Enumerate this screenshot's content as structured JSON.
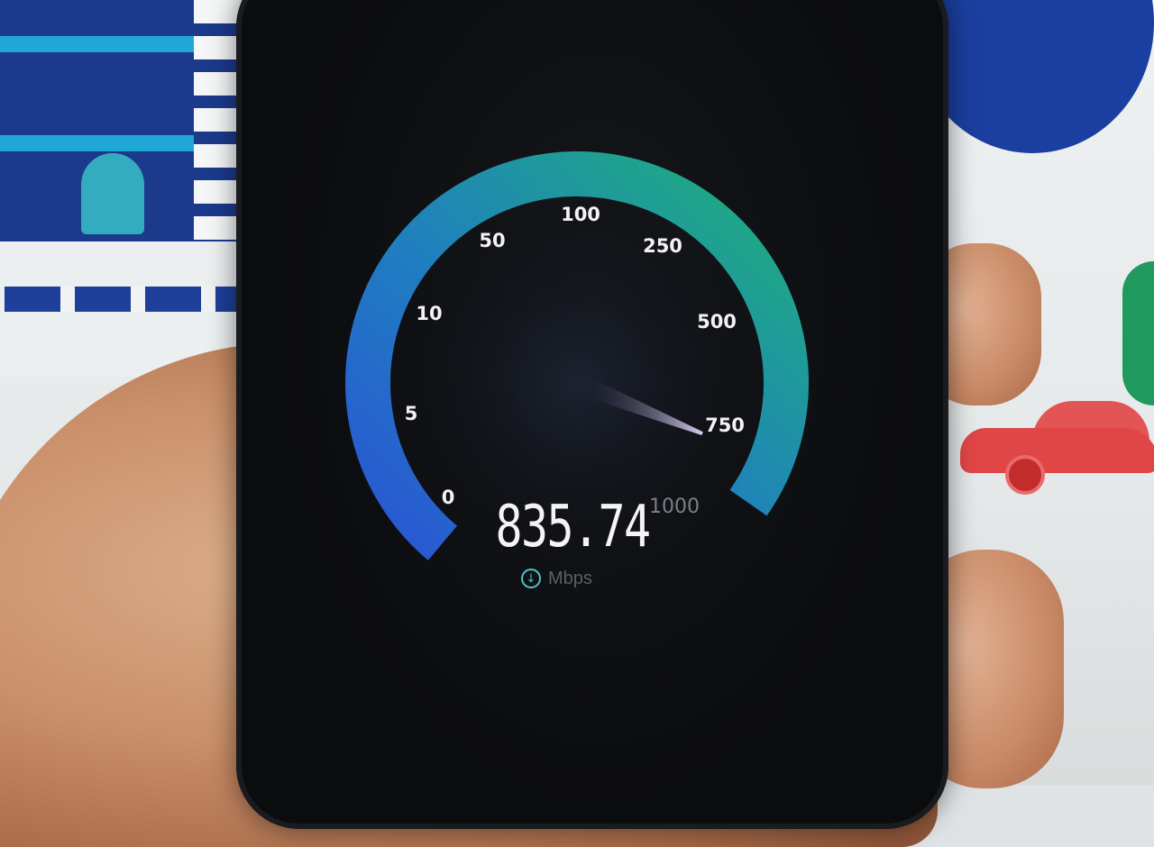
{
  "speedtest": {
    "scale_labels": [
      "0",
      "5",
      "10",
      "50",
      "100",
      "250",
      "500",
      "750",
      "1000"
    ],
    "reading": "835.74",
    "unit": "Mbps",
    "direction_icon": "download-arrow-icon",
    "gauge_colors": {
      "start": "#2a5fd6",
      "mid": "#1f86b8",
      "end": "#1faa7a"
    },
    "needle_color": "#d9cff2"
  }
}
